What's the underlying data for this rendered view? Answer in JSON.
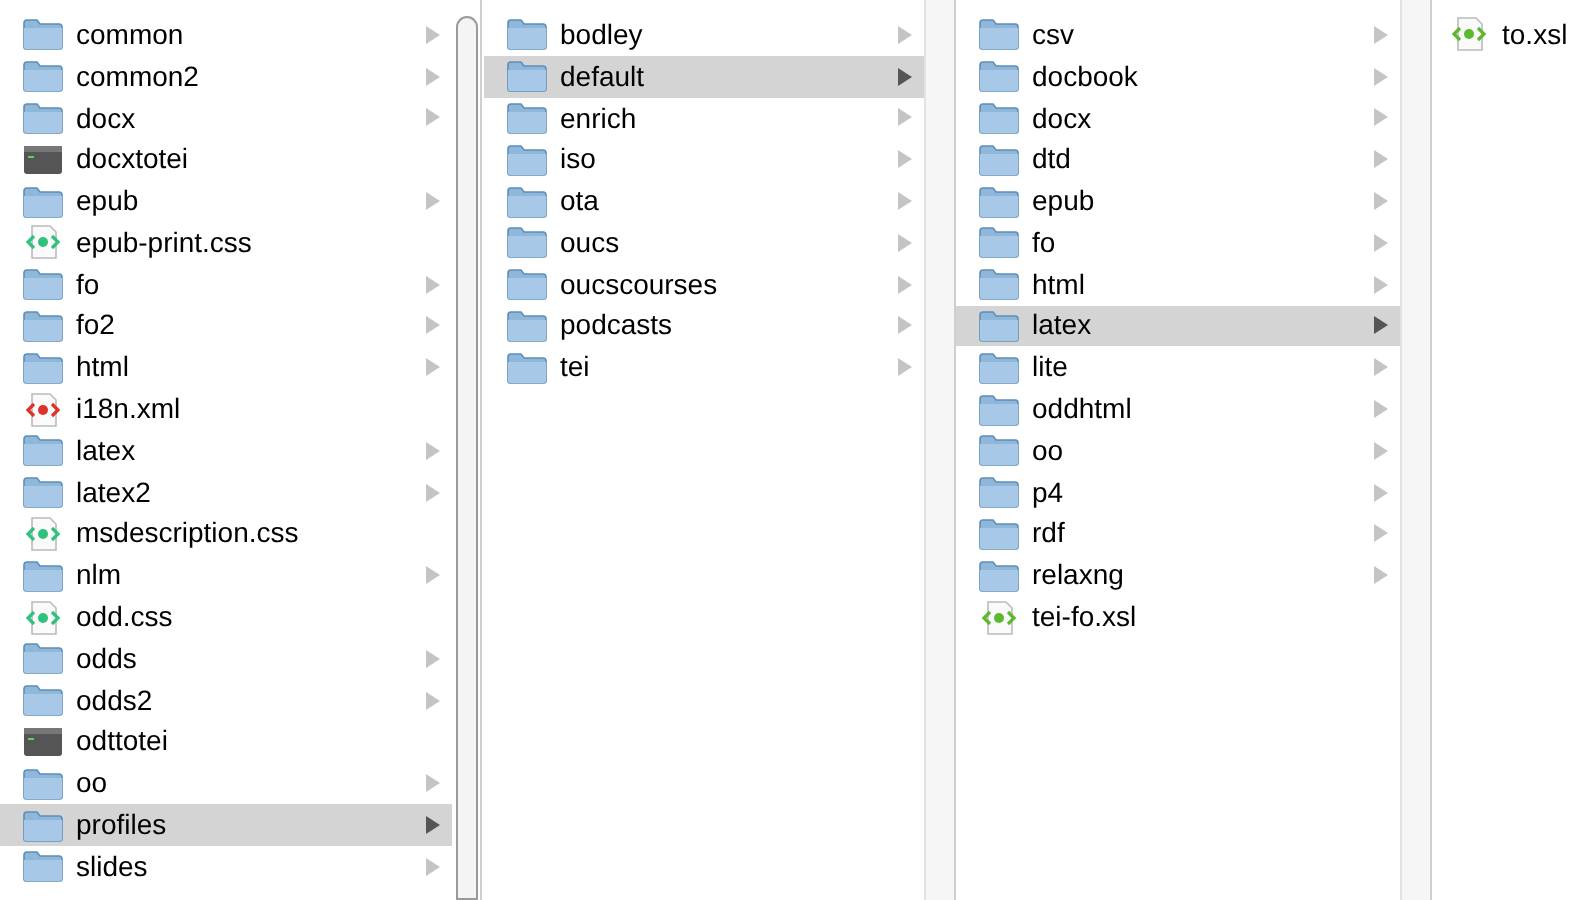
{
  "columns": [
    {
      "items": [
        {
          "name": "common",
          "kind": "folder",
          "selected": false
        },
        {
          "name": "common2",
          "kind": "folder",
          "selected": false
        },
        {
          "name": "docx",
          "kind": "folder",
          "selected": false
        },
        {
          "name": "docxtotei",
          "kind": "executable",
          "selected": false
        },
        {
          "name": "epub",
          "kind": "folder",
          "selected": false
        },
        {
          "name": "epub-print.css",
          "kind": "css",
          "selected": false
        },
        {
          "name": "fo",
          "kind": "folder",
          "selected": false
        },
        {
          "name": "fo2",
          "kind": "folder",
          "selected": false
        },
        {
          "name": "html",
          "kind": "folder",
          "selected": false
        },
        {
          "name": "i18n.xml",
          "kind": "xml",
          "selected": false
        },
        {
          "name": "latex",
          "kind": "folder",
          "selected": false
        },
        {
          "name": "latex2",
          "kind": "folder",
          "selected": false
        },
        {
          "name": "msdescription.css",
          "kind": "css",
          "selected": false
        },
        {
          "name": "nlm",
          "kind": "folder",
          "selected": false
        },
        {
          "name": "odd.css",
          "kind": "css",
          "selected": false
        },
        {
          "name": "odds",
          "kind": "folder",
          "selected": false
        },
        {
          "name": "odds2",
          "kind": "folder",
          "selected": false
        },
        {
          "name": "odttotei",
          "kind": "executable",
          "selected": false
        },
        {
          "name": "oo",
          "kind": "folder",
          "selected": false
        },
        {
          "name": "profiles",
          "kind": "folder",
          "selected": true
        },
        {
          "name": "slides",
          "kind": "folder",
          "selected": false
        }
      ]
    },
    {
      "items": [
        {
          "name": "bodley",
          "kind": "folder",
          "selected": false
        },
        {
          "name": "default",
          "kind": "folder",
          "selected": true
        },
        {
          "name": "enrich",
          "kind": "folder",
          "selected": false
        },
        {
          "name": "iso",
          "kind": "folder",
          "selected": false
        },
        {
          "name": "ota",
          "kind": "folder",
          "selected": false
        },
        {
          "name": "oucs",
          "kind": "folder",
          "selected": false
        },
        {
          "name": "oucscourses",
          "kind": "folder",
          "selected": false
        },
        {
          "name": "podcasts",
          "kind": "folder",
          "selected": false
        },
        {
          "name": "tei",
          "kind": "folder",
          "selected": false
        }
      ]
    },
    {
      "items": [
        {
          "name": "csv",
          "kind": "folder",
          "selected": false
        },
        {
          "name": "docbook",
          "kind": "folder",
          "selected": false
        },
        {
          "name": "docx",
          "kind": "folder",
          "selected": false
        },
        {
          "name": "dtd",
          "kind": "folder",
          "selected": false
        },
        {
          "name": "epub",
          "kind": "folder",
          "selected": false
        },
        {
          "name": "fo",
          "kind": "folder",
          "selected": false
        },
        {
          "name": "html",
          "kind": "folder",
          "selected": false
        },
        {
          "name": "latex",
          "kind": "folder",
          "selected": true
        },
        {
          "name": "lite",
          "kind": "folder",
          "selected": false
        },
        {
          "name": "oddhtml",
          "kind": "folder",
          "selected": false
        },
        {
          "name": "oo",
          "kind": "folder",
          "selected": false
        },
        {
          "name": "p4",
          "kind": "folder",
          "selected": false
        },
        {
          "name": "rdf",
          "kind": "folder",
          "selected": false
        },
        {
          "name": "relaxng",
          "kind": "folder",
          "selected": false
        },
        {
          "name": "tei-fo.xsl",
          "kind": "xsl",
          "selected": false
        }
      ]
    },
    {
      "items": [
        {
          "name": "to.xsl",
          "kind": "xsl",
          "selected": false
        }
      ]
    }
  ]
}
